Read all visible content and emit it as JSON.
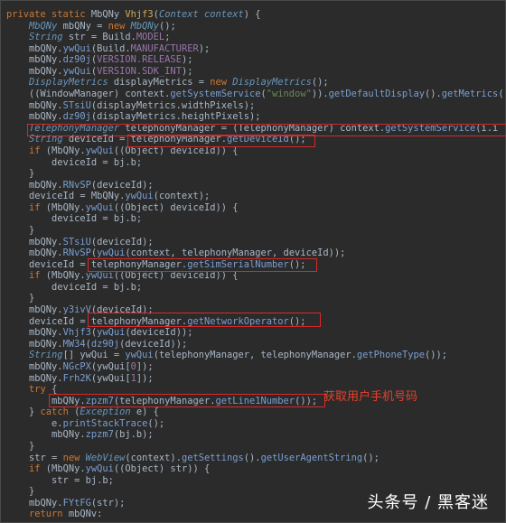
{
  "code_lines": [
    [
      [
        "kw",
        "private static "
      ],
      [
        "txt",
        "MbQNy "
      ],
      [
        "fn",
        "Vhjf3"
      ],
      [
        "txt",
        "("
      ],
      [
        "ty",
        "Context context"
      ],
      [
        "txt",
        ") {"
      ]
    ],
    [
      [
        "txt",
        "    "
      ],
      [
        "ty",
        "MbQNy"
      ],
      [
        "txt",
        " mbQNy = "
      ],
      [
        "kw",
        "new "
      ],
      [
        "ty",
        "MbQNy"
      ],
      [
        "txt",
        "();"
      ]
    ],
    [
      [
        "txt",
        "    "
      ],
      [
        "ty",
        "String"
      ],
      [
        "txt",
        " str = Build."
      ],
      [
        "fd",
        "MODEL"
      ],
      [
        "txt",
        ";"
      ]
    ],
    [
      [
        "txt",
        "    mbQNy."
      ],
      [
        "mt",
        "ywQui"
      ],
      [
        "txt",
        "(Build."
      ],
      [
        "fd",
        "MANUFACTURER"
      ],
      [
        "txt",
        ");"
      ]
    ],
    [
      [
        "txt",
        "    mbQNy."
      ],
      [
        "mt",
        "dz90j"
      ],
      [
        "txt",
        "("
      ],
      [
        "fd",
        "VERSION.RELEASE"
      ],
      [
        "txt",
        ");"
      ]
    ],
    [
      [
        "txt",
        "    mbQNy."
      ],
      [
        "mt",
        "ywQui"
      ],
      [
        "txt",
        "("
      ],
      [
        "fd",
        "VERSION.SDK_INT"
      ],
      [
        "txt",
        ");"
      ]
    ],
    [
      [
        "txt",
        "    "
      ],
      [
        "ty",
        "DisplayMetrics"
      ],
      [
        "txt",
        " displayMetrics = "
      ],
      [
        "kw",
        "new "
      ],
      [
        "ty",
        "DisplayMetrics"
      ],
      [
        "txt",
        "();"
      ]
    ],
    [
      [
        "txt",
        "    ((WindowManager) context."
      ],
      [
        "mt",
        "getSystemService"
      ],
      [
        "txt",
        "("
      ],
      [
        "str",
        "\"window\""
      ],
      [
        "txt",
        "))."
      ],
      [
        "mt",
        "getDefaultDisplay"
      ],
      [
        "txt",
        "()."
      ],
      [
        "mt",
        "getMetrics"
      ],
      [
        "txt",
        "("
      ]
    ],
    [
      [
        "txt",
        "    mbQNy."
      ],
      [
        "mt",
        "STsiU"
      ],
      [
        "txt",
        "(displayMetrics.widthPixels);"
      ]
    ],
    [
      [
        "txt",
        "    mbQNy."
      ],
      [
        "mt",
        "dz90j"
      ],
      [
        "txt",
        "(displayMetrics.heightPixels);"
      ]
    ],
    [
      [
        "txt",
        "    "
      ],
      [
        "ty",
        "TelephonyManager"
      ],
      [
        "txt",
        " telephonyManager = (TelephonyManager) context."
      ],
      [
        "mt",
        "getSystemService"
      ],
      [
        "txt",
        "(i.i"
      ]
    ],
    [
      [
        "txt",
        "    "
      ],
      [
        "ty",
        "String"
      ],
      [
        "txt",
        " deviceId = telephonyManager."
      ],
      [
        "mt",
        "getDeviceId"
      ],
      [
        "txt",
        "();"
      ]
    ],
    [
      [
        "txt",
        "    "
      ],
      [
        "kw",
        "if"
      ],
      [
        "txt",
        " (MbQNy."
      ],
      [
        "mt",
        "ywQui"
      ],
      [
        "txt",
        "((Object) deviceId)) {"
      ]
    ],
    [
      [
        "txt",
        "        deviceId = bj.b;"
      ]
    ],
    [
      [
        "txt",
        "    }"
      ]
    ],
    [
      [
        "txt",
        "    mbQNy."
      ],
      [
        "mt",
        "RNvSP"
      ],
      [
        "txt",
        "(deviceId);"
      ]
    ],
    [
      [
        "txt",
        "    deviceId = MbQNy."
      ],
      [
        "mt",
        "ywQui"
      ],
      [
        "txt",
        "(context);"
      ]
    ],
    [
      [
        "txt",
        "    "
      ],
      [
        "kw",
        "if"
      ],
      [
        "txt",
        " (MbQNy."
      ],
      [
        "mt",
        "ywQui"
      ],
      [
        "txt",
        "((Object) deviceId)) {"
      ]
    ],
    [
      [
        "txt",
        "        deviceId = bj.b;"
      ]
    ],
    [
      [
        "txt",
        "    }"
      ]
    ],
    [
      [
        "txt",
        "    mbQNy."
      ],
      [
        "mt",
        "STsiU"
      ],
      [
        "txt",
        "(deviceId);"
      ]
    ],
    [
      [
        "txt",
        "    mbQNy."
      ],
      [
        "mt",
        "RNvSP"
      ],
      [
        "txt",
        "("
      ],
      [
        "mt",
        "ywQui"
      ],
      [
        "txt",
        "(context, telephonyManager, deviceId));"
      ]
    ],
    [
      [
        "txt",
        "    deviceId = telephonyManager."
      ],
      [
        "mt",
        "getSimSerialNumber"
      ],
      [
        "txt",
        "();"
      ]
    ],
    [
      [
        "txt",
        "    "
      ],
      [
        "kw",
        "if"
      ],
      [
        "txt",
        " (MbQNy."
      ],
      [
        "mt",
        "ywQui"
      ],
      [
        "txt",
        "((Object) deviceId)) {"
      ]
    ],
    [
      [
        "txt",
        "        deviceId = bj.b;"
      ]
    ],
    [
      [
        "txt",
        "    }"
      ]
    ],
    [
      [
        "txt",
        "    mbQNy."
      ],
      [
        "mt",
        "y3ivV"
      ],
      [
        "txt",
        "(deviceId);"
      ]
    ],
    [
      [
        "txt",
        "    deviceId = telephonyManager."
      ],
      [
        "mt",
        "getNetworkOperator"
      ],
      [
        "txt",
        "();"
      ]
    ],
    [
      [
        "txt",
        "    mbQNy."
      ],
      [
        "mt",
        "Vhjf3"
      ],
      [
        "txt",
        "("
      ],
      [
        "mt",
        "ywQui"
      ],
      [
        "txt",
        "(deviceId));"
      ]
    ],
    [
      [
        "txt",
        "    mbQNy."
      ],
      [
        "mt",
        "MW34"
      ],
      [
        "txt",
        "("
      ],
      [
        "mt",
        "dz90j"
      ],
      [
        "txt",
        "(deviceId));"
      ]
    ],
    [
      [
        "txt",
        "    "
      ],
      [
        "ty",
        "String"
      ],
      [
        "txt",
        "[] ywQui = "
      ],
      [
        "mt",
        "ywQui"
      ],
      [
        "txt",
        "(telephonyManager, telephonyManager."
      ],
      [
        "mt",
        "getPhoneType"
      ],
      [
        "txt",
        "());"
      ]
    ],
    [
      [
        "txt",
        "    mbQNy."
      ],
      [
        "mt",
        "NGcPX"
      ],
      [
        "txt",
        "(ywQui["
      ],
      [
        "fd",
        "0"
      ],
      [
        "txt",
        "]);"
      ]
    ],
    [
      [
        "txt",
        "    mbQNy."
      ],
      [
        "mt",
        "Frh2K"
      ],
      [
        "txt",
        "(ywQui["
      ],
      [
        "fd",
        "1"
      ],
      [
        "txt",
        "]);"
      ]
    ],
    [
      [
        "txt",
        "    "
      ],
      [
        "kw",
        "try"
      ],
      [
        "txt",
        " {"
      ]
    ],
    [
      [
        "txt",
        "        mbQNy."
      ],
      [
        "mt",
        "zpzm7"
      ],
      [
        "txt",
        "(telephonyManager."
      ],
      [
        "mt",
        "getLine1Number"
      ],
      [
        "txt",
        "());"
      ]
    ],
    [
      [
        "txt",
        "    } "
      ],
      [
        "kw",
        "catch"
      ],
      [
        "txt",
        " ("
      ],
      [
        "ty",
        "Exception"
      ],
      [
        "txt",
        " e) {"
      ]
    ],
    [
      [
        "txt",
        "        e."
      ],
      [
        "mt",
        "printStackTrace"
      ],
      [
        "txt",
        "();"
      ]
    ],
    [
      [
        "txt",
        "        mbQNy."
      ],
      [
        "mt",
        "zpzm7"
      ],
      [
        "txt",
        "(bj.b);"
      ]
    ],
    [
      [
        "txt",
        "    }"
      ]
    ],
    [
      [
        "txt",
        "    str = "
      ],
      [
        "kw",
        "new "
      ],
      [
        "ty",
        "WebView"
      ],
      [
        "txt",
        "(context)."
      ],
      [
        "mt",
        "getSettings"
      ],
      [
        "txt",
        "()."
      ],
      [
        "mt",
        "getUserAgentString"
      ],
      [
        "txt",
        "();"
      ]
    ],
    [
      [
        "txt",
        "    "
      ],
      [
        "kw",
        "if"
      ],
      [
        "txt",
        " (MbQNy."
      ],
      [
        "mt",
        "ywQui"
      ],
      [
        "txt",
        "((Object) str)) {"
      ]
    ],
    [
      [
        "txt",
        "        str = bj.b;"
      ]
    ],
    [
      [
        "txt",
        "    }"
      ]
    ],
    [
      [
        "txt",
        "    mbQNy."
      ],
      [
        "mt",
        "FYtFG"
      ],
      [
        "txt",
        "(str);"
      ]
    ],
    [
      [
        "txt",
        "    "
      ],
      [
        "kw",
        "return"
      ],
      [
        "txt",
        " mbQNv:"
      ]
    ]
  ],
  "annotation_text": "获取用户手机号码",
  "watermark_text": "头条号 / 黑客迷",
  "highlight_color": "#d62a2a"
}
